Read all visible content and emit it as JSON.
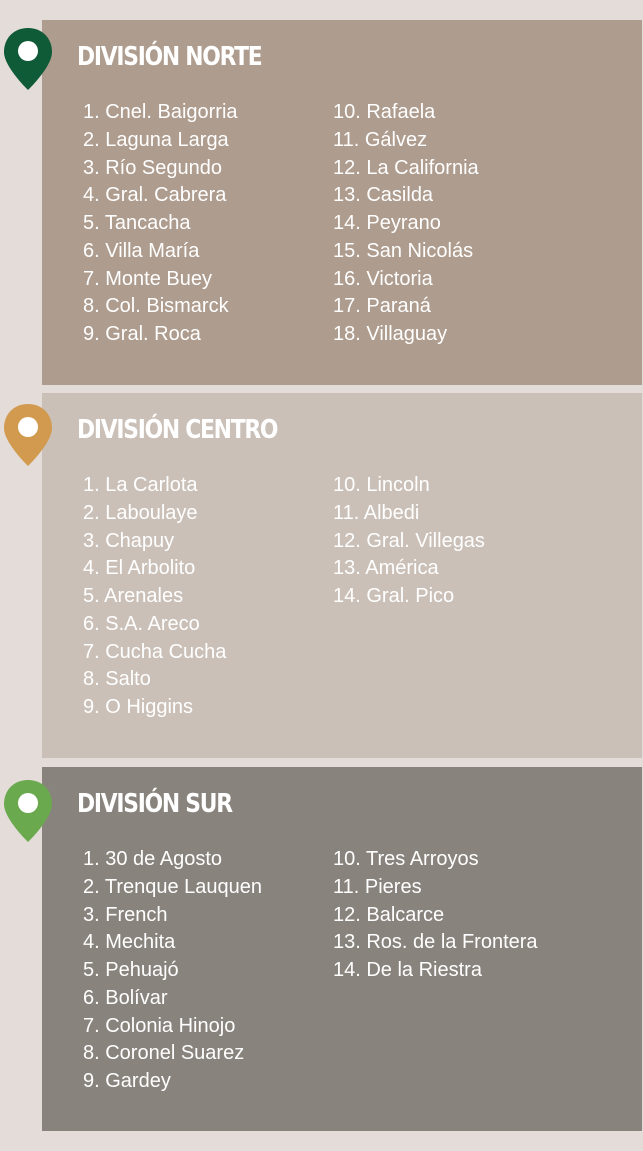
{
  "colors": {
    "background": "#e3dcd8",
    "norte_panel": "#ae9c8e",
    "centro_panel": "#cac0b8",
    "sur_panel": "#89837d",
    "norte_pin": "#0f5a37",
    "centro_pin": "#d29a4f",
    "sur_pin": "#6aa94d",
    "text": "#ffffff"
  },
  "divisions": [
    {
      "title": "DIVISIÓN NORTE",
      "pin_icon": "map-pin-icon",
      "left_items": [
        "1. Cnel. Baigorria",
        "2. Laguna Larga",
        "3. Río Segundo",
        "4. Gral. Cabrera",
        "5. Tancacha",
        "6. Villa María",
        "7. Monte Buey",
        "8. Col. Bismarck",
        "9. Gral. Roca"
      ],
      "right_items": [
        "10. Rafaela",
        "11. Gálvez",
        "12. La California",
        "13. Casilda",
        "14. Peyrano",
        "15. San Nicolás",
        "16. Victoria",
        "17. Paraná",
        "18. Villaguay"
      ]
    },
    {
      "title": "DIVISIÓN CENTRO",
      "pin_icon": "map-pin-icon",
      "left_items": [
        "1. La Carlota",
        "2. Laboulaye",
        "3. Chapuy",
        "4. El Arbolito",
        "5. Arenales",
        "6. S.A. Areco",
        "7. Cucha Cucha",
        "8. Salto",
        "9. O Higgins"
      ],
      "right_items": [
        "10. Lincoln",
        "11. Albedi",
        "12. Gral. Villegas",
        "13. América",
        "14. Gral. Pico"
      ]
    },
    {
      "title": "DIVISIÓN SUR",
      "pin_icon": "map-pin-icon",
      "left_items": [
        "1. 30 de Agosto",
        "2. Trenque Lauquen",
        "3. French",
        "4. Mechita",
        "5. Pehuajó",
        "6. Bolívar",
        "7. Colonia Hinojo",
        "8. Coronel Suarez",
        "9. Gardey"
      ],
      "right_items": [
        "10. Tres Arroyos",
        "11. Pieres",
        "12. Balcarce",
        "13. Ros. de la Frontera",
        "14. De la Riestra"
      ]
    }
  ]
}
